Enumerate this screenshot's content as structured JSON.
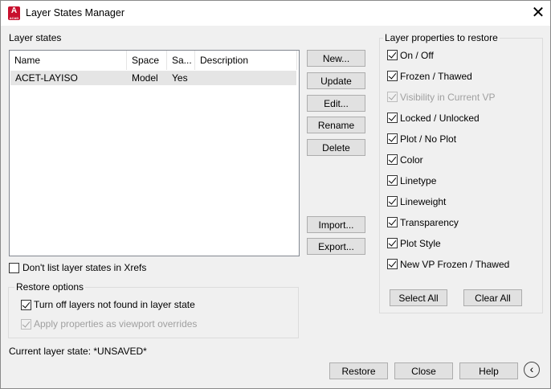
{
  "window": {
    "title": "Layer States Manager",
    "app_icon_letter": "A",
    "app_icon_sub": "ACAD",
    "close_glyph": "✕"
  },
  "layer_states": {
    "label": "Layer states",
    "columns": [
      "Name",
      "Space",
      "Sa...",
      "Description"
    ],
    "rows": [
      {
        "name": "ACET-LAYISO",
        "space": "Model",
        "saved": "Yes",
        "description": ""
      }
    ]
  },
  "buttons": {
    "new": "New...",
    "update": "Update",
    "edit": "Edit...",
    "rename": "Rename",
    "delete": "Delete",
    "import": "Import...",
    "export": "Export...",
    "select_all": "Select All",
    "clear_all": "Clear All",
    "restore": "Restore",
    "close": "Close",
    "help": "Help",
    "collapse_icon": "‹"
  },
  "xrefs": {
    "label": "Don't list layer states in Xrefs",
    "checked": false
  },
  "restore_options": {
    "title": "Restore options",
    "turn_off": {
      "label": "Turn off layers not found in layer state",
      "checked": true
    },
    "apply_overrides": {
      "label": "Apply properties as viewport overrides",
      "checked": true,
      "disabled": true
    }
  },
  "current_state": "Current layer state: *UNSAVED*",
  "properties": {
    "title": "Layer properties to restore",
    "items": [
      {
        "label": "On / Off",
        "checked": true,
        "disabled": false
      },
      {
        "label": "Frozen / Thawed",
        "checked": true,
        "disabled": false
      },
      {
        "label": "Visibility in Current VP",
        "checked": true,
        "disabled": true
      },
      {
        "label": "Locked / Unlocked",
        "checked": true,
        "disabled": false
      },
      {
        "label": "Plot / No Plot",
        "checked": true,
        "disabled": false
      },
      {
        "label": "Color",
        "checked": true,
        "disabled": false
      },
      {
        "label": "Linetype",
        "checked": true,
        "disabled": false
      },
      {
        "label": "Lineweight",
        "checked": true,
        "disabled": false
      },
      {
        "label": "Transparency",
        "checked": true,
        "disabled": false
      },
      {
        "label": "Plot Style",
        "checked": true,
        "disabled": false
      },
      {
        "label": "New VP Frozen / Thawed",
        "checked": true,
        "disabled": false
      }
    ]
  }
}
